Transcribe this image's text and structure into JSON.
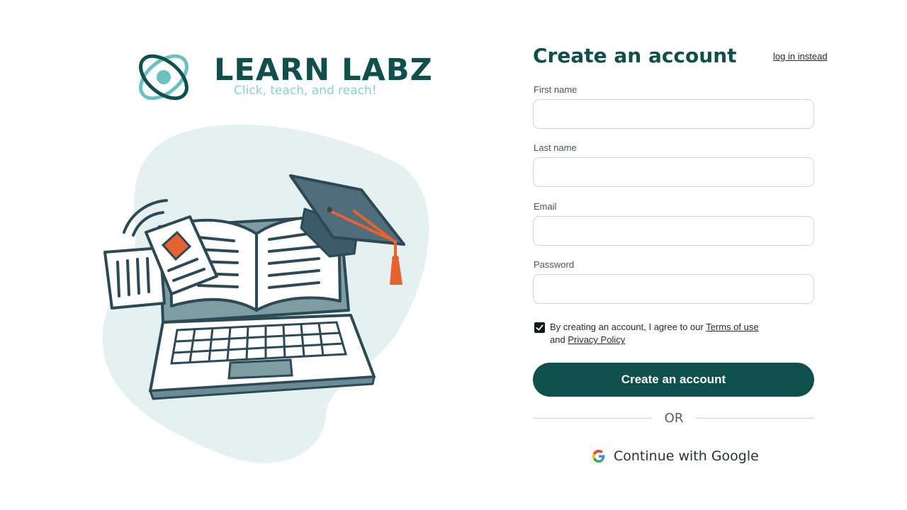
{
  "brand": {
    "name": "LEARN LABZ",
    "tagline": "Click, teach, and reach!"
  },
  "form": {
    "title": "Create an account",
    "login_link": "log in instead",
    "fields": [
      {
        "label": "First name",
        "value": "",
        "placeholder": ""
      },
      {
        "label": "Last name",
        "value": "",
        "placeholder": ""
      },
      {
        "label": "Email",
        "value": "",
        "placeholder": ""
      },
      {
        "label": "Password",
        "value": "",
        "placeholder": ""
      }
    ],
    "agreement": {
      "checked": true,
      "prefix": "By creating an account, I agree to our ",
      "terms_link": "Terms of use",
      "middle": "and ",
      "privacy_link": "Privacy Policy"
    },
    "submit_label": "Create an account",
    "divider": "OR",
    "google_label": "Continue with Google"
  },
  "colors": {
    "brand_primary": "#0f4f4c",
    "brand_accent": "#6cc0bf",
    "tagline": "#8ccfcf",
    "illustration_accent": "#e8622f",
    "blob": "#e5f1f0"
  },
  "icons": {
    "logo": "atom-logo-icon",
    "checkbox": "checkmark-icon",
    "google": "google-g-icon"
  }
}
